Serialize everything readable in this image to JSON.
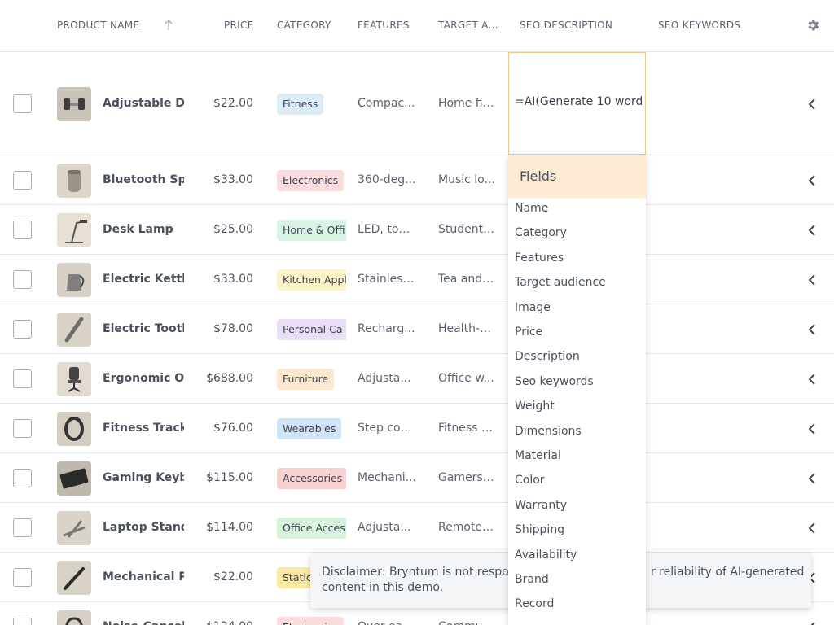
{
  "header": {
    "columns": {
      "product_name": "PRODUCT NAME",
      "price": "PRICE",
      "category": "CATEGORY",
      "features": "FEATURES",
      "target": "TARGET A...",
      "seo_description": "SEO DESCRIPTION",
      "seo_keywords": "SEO KEYWORDS"
    },
    "sort_icon": "arrow-up-icon",
    "settings_icon": "gear-icon"
  },
  "editor": {
    "value": "=AI(Generate 10 word"
  },
  "fields_popup": {
    "title": "Fields",
    "items": [
      "Name",
      "Category",
      "Features",
      "Target audience",
      "Image",
      "Price",
      "Description",
      "Seo keywords",
      "Weight",
      "Dimensions",
      "Material",
      "Color",
      "Warranty",
      "Shipping",
      "Availability",
      "Brand",
      "Record"
    ]
  },
  "disclaimer": {
    "left_text": "Disclaimer: Bryntum is not respon",
    "right_text": "r reliability of AI-generated",
    "second_line": "content in this demo."
  },
  "colors": {
    "Fitness": "#dcecf8",
    "Electronics": "#fadcdc",
    "Home": "#d8f3e3",
    "Kitchen": "#fdf3c8",
    "Personal": "#e9def3",
    "Furniture": "#fde8cf",
    "Wearables": "#cfe4f6",
    "Accessories": "#f8d2d2",
    "Office": "#d6f2dc",
    "Stationery": "#fbe9a8"
  },
  "rows": [
    {
      "name": "Adjustable Du",
      "price": "$22.00",
      "category": "Fitness",
      "color": "#dcecf8",
      "features": "Compac...",
      "target": "Home fit...",
      "thumb": "dumbbell"
    },
    {
      "name": "Bluetooth Spe",
      "price": "$33.00",
      "category": "Electronics",
      "color": "#fadcdc",
      "features": "360-deg...",
      "target": "Music lo...",
      "thumb": "speaker"
    },
    {
      "name": "Desk Lamp",
      "price": "$25.00",
      "category": "Home & Offi",
      "color": "#d8f3e3",
      "features": "LED, touc...",
      "target": "Students...",
      "thumb": "lamp"
    },
    {
      "name": "Electric Kettle",
      "price": "$33.00",
      "category": "Kitchen Appl",
      "color": "#fdf3c8",
      "features": "Stainless...",
      "target": "Tea and ...",
      "thumb": "kettle"
    },
    {
      "name": "Electric Toothl",
      "price": "$78.00",
      "category": "Personal Ca",
      "color": "#e9def3",
      "features": "Recharg...",
      "target": "Health-c...",
      "thumb": "toothbrush"
    },
    {
      "name": "Ergonomic Off",
      "price": "$688.00",
      "category": "Furniture",
      "color": "#fde8cf",
      "features": "Adjusta...",
      "target": "Office w...",
      "thumb": "chair"
    },
    {
      "name": "Fitness Tracke",
      "price": "$76.00",
      "category": "Wearables",
      "color": "#cfe4f6",
      "features": "Step cou...",
      "target": "Fitness e...",
      "thumb": "tracker"
    },
    {
      "name": "Gaming Keyb",
      "price": "$115.00",
      "category": "Accessories",
      "color": "#f8d2d2",
      "features": "Mechani...",
      "target": "Gamers,...",
      "thumb": "keyboard"
    },
    {
      "name": "Laptop Stand",
      "price": "$114.00",
      "category": "Office Acces",
      "color": "#d6f2dc",
      "features": "Adjusta...",
      "target": "Remote ...",
      "thumb": "stand"
    },
    {
      "name": "Mechanical Pe",
      "price": "$22.00",
      "category": "Static",
      "color": "#fbe9a8",
      "features": "",
      "target": "",
      "thumb": "pen"
    },
    {
      "name": "Noise-Cancel",
      "price": "$124.00",
      "category": "Electronics",
      "color": "#fadcdc",
      "features": "Over-ea...",
      "target": "Commu...",
      "thumb": "headphones"
    }
  ]
}
